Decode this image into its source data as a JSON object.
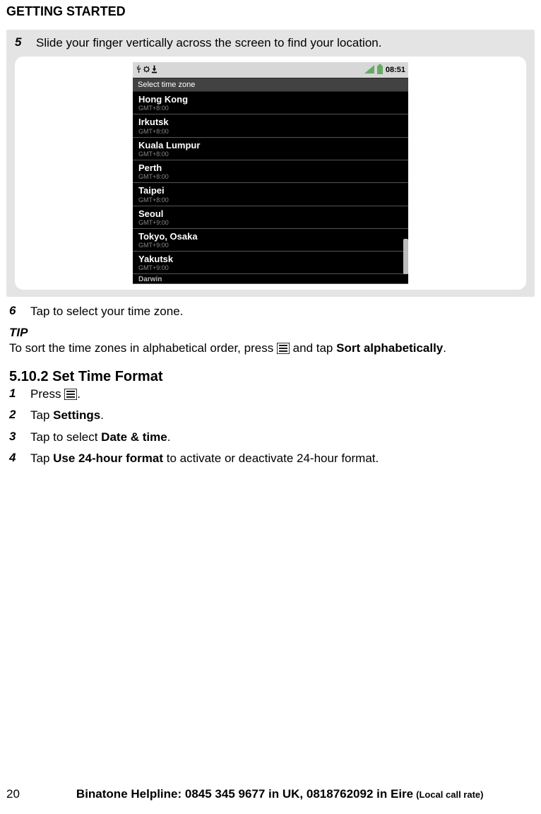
{
  "header": "GETTING STARTED",
  "step5": {
    "num": "5",
    "text": "Slide your finger vertically across the screen to find your location."
  },
  "phone": {
    "time": "08:51",
    "title": "Select time zone",
    "zones": [
      {
        "name": "Hong Kong",
        "offset": "GMT+8:00"
      },
      {
        "name": "Irkutsk",
        "offset": "GMT+8:00"
      },
      {
        "name": "Kuala Lumpur",
        "offset": "GMT+8:00"
      },
      {
        "name": "Perth",
        "offset": "GMT+8:00"
      },
      {
        "name": "Taipei",
        "offset": "GMT+8:00"
      },
      {
        "name": "Seoul",
        "offset": "GMT+9:00"
      },
      {
        "name": "Tokyo, Osaka",
        "offset": "GMT+9:00"
      },
      {
        "name": "Yakutsk",
        "offset": "GMT+9:00"
      }
    ],
    "last_partial": "Darwin"
  },
  "step6": {
    "num": "6",
    "text": "Tap to select your time zone."
  },
  "tip": {
    "heading": "TIP",
    "pre": "To sort the time zones in alphabetical order, press ",
    "mid": " and tap ",
    "bold": "Sort alphabetically",
    "end": "."
  },
  "section": "5.10.2 Set Time Format",
  "steps": {
    "s1": {
      "num": "1",
      "pre": "Press ",
      "end": "."
    },
    "s2": {
      "num": "2",
      "pre": "Tap ",
      "bold": "Settings",
      "end": "."
    },
    "s3": {
      "num": "3",
      "pre": "Tap to select ",
      "bold": "Date & time",
      "end": "."
    },
    "s4": {
      "num": "4",
      "pre": "Tap ",
      "bold": "Use 24-hour format",
      "post": " to activate or deactivate 24-hour format."
    }
  },
  "footer": {
    "page": "20",
    "text": "Binatone Helpline: 0845 345 9677 in UK, 0818762092 in Eire",
    "suffix": " (Local call rate)"
  }
}
